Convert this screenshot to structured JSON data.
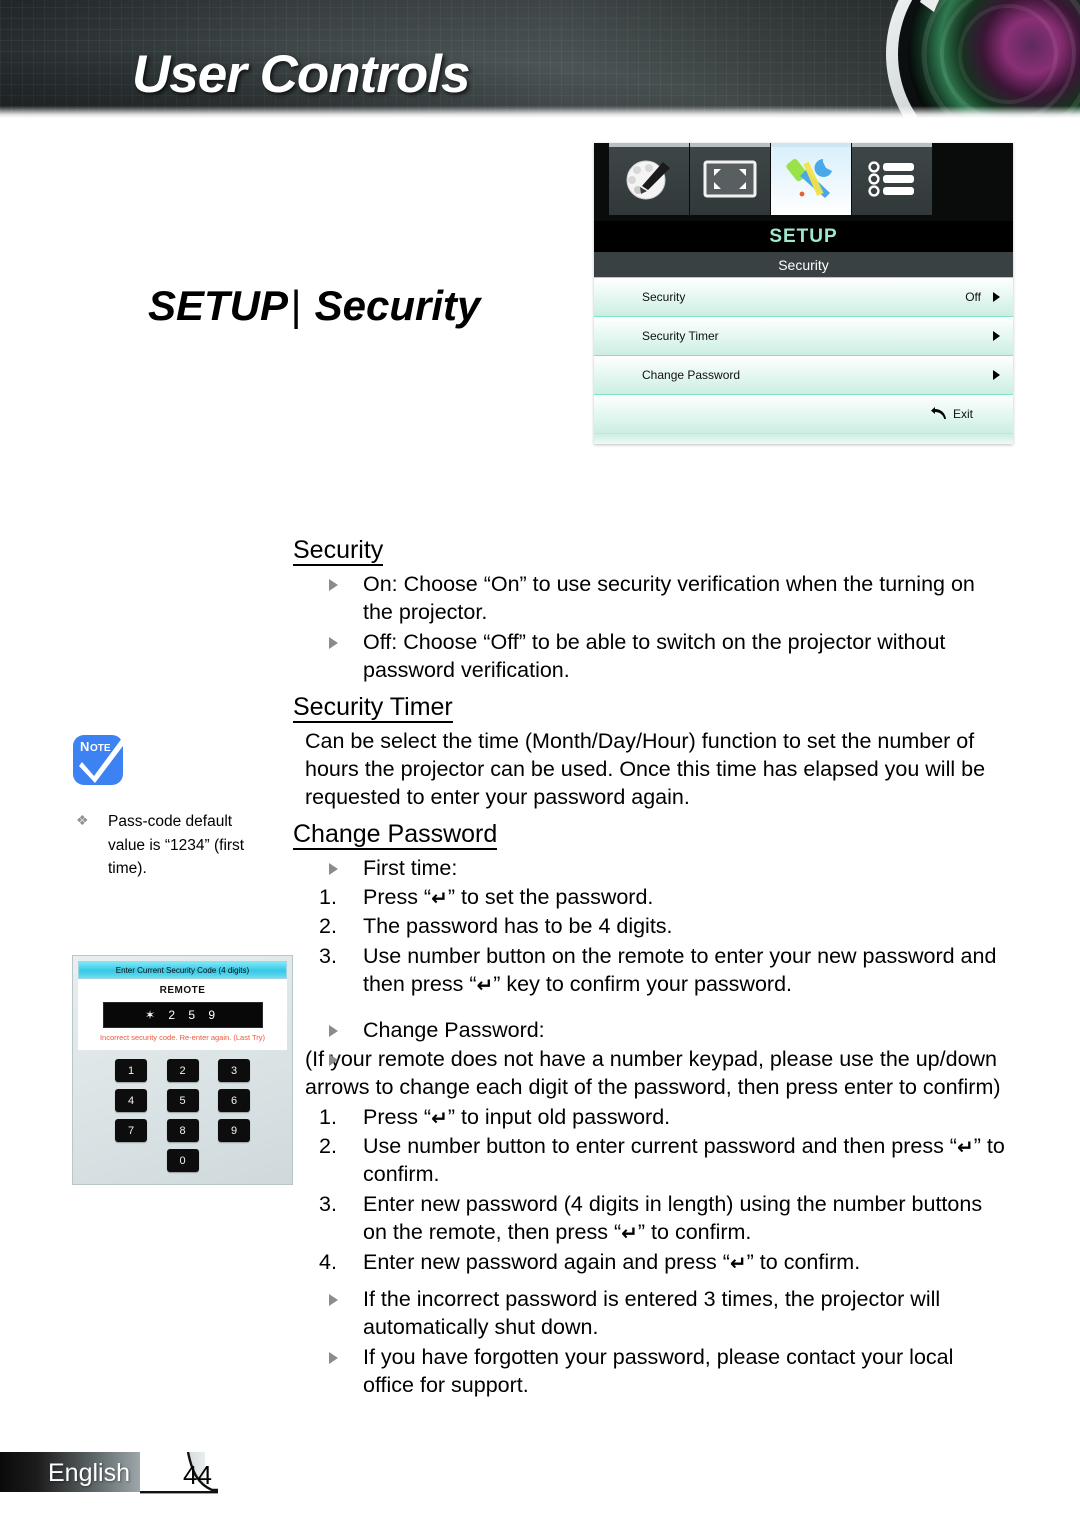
{
  "header": {
    "title": "User Controls"
  },
  "page_title": {
    "primary": "SETUP",
    "separator": "|",
    "secondary": "Security"
  },
  "osd": {
    "tabs": [
      {
        "name": "image-palette-tab",
        "icon": "palette-brush-icon",
        "selected": false
      },
      {
        "name": "display-tab",
        "icon": "screen-resize-icon",
        "selected": false
      },
      {
        "name": "setup-tab",
        "icon": "tools-icon",
        "selected": true
      },
      {
        "name": "options-tab",
        "icon": "list-options-icon",
        "selected": false
      }
    ],
    "title": "SETUP",
    "subtitle": "Security",
    "rows": [
      {
        "label": "Security",
        "value": "Off"
      },
      {
        "label": "Security Timer",
        "value": ""
      },
      {
        "label": "Change Password",
        "value": ""
      }
    ],
    "exit_label": "Exit",
    "accent_color": "#9fe8cf",
    "row_color": "#ddf5ec"
  },
  "sections": [
    {
      "heading": "Security",
      "bullets": [
        "On: Choose “On” to use security verification when the turning on the projector.",
        "Off: Choose “Off” to be able to switch on the projector without password verification."
      ]
    },
    {
      "heading": "Security Timer",
      "paragraph": "Can be select the time (Month/Day/Hour) function to set the number of hours the projector can be used. Once this time has elapsed you will be requested to enter your password again."
    },
    {
      "heading": "Change Password"
    }
  ],
  "change_password": {
    "first_time_bullet": "First time:",
    "first_time_steps": [
      {
        "n": "1.",
        "pre": "Press “",
        "post": "” to set the password."
      },
      {
        "n": "2.",
        "pre": "",
        "post": "The password has to be 4 digits.",
        "no_key": true
      },
      {
        "n": "3.",
        "pre": "Use number button on the remote to enter your new password and then press “",
        "post": "” key to confirm your password.",
        "key_mid": true
      }
    ],
    "change_bullet": "Change Password:",
    "change_note": "(If your remote does not have  a number keypad, please  use the up/down arrows to change each digit of the password, then press enter to confirm)",
    "change_steps": [
      {
        "n": "1.",
        "pre": "Press “",
        "post": "” to input old password."
      },
      {
        "n": "2.",
        "pre": "Use number button to enter current password and then press “",
        "post": "” to confirm.",
        "key_mid": true
      },
      {
        "n": "3.",
        "pre": "Enter new password (4 digits in length) using the number buttons on the remote, then press “",
        "post": "” to confirm.",
        "key_mid": true
      },
      {
        "n": "4.",
        "pre": "Enter new password again and press “",
        "post": "” to confirm.",
        "key_mid": true
      }
    ],
    "trailing_bullets": [
      "If the incorrect password is entered 3 times, the projector will automatically shut down.",
      "If you have forgotten your password, please contact your local office for support."
    ],
    "enter_key_glyph": "↵"
  },
  "note": {
    "badge_label": "Note",
    "text": "Pass-code default value is “1234” (first time)."
  },
  "dialog": {
    "title": "Enter Current Security Code (4 digits)",
    "device_label": "REMOTE",
    "code_value": "✶ 2 5 9",
    "error": "Incorrect security code. Re-enter again. (Last Try)",
    "keypad": [
      [
        "1",
        "2",
        "3"
      ],
      [
        "4",
        "5",
        "6"
      ],
      [
        "7",
        "8",
        "9"
      ],
      [
        "0"
      ]
    ],
    "title_color": "#35c8e6",
    "error_color": "#f0583c"
  },
  "footer": {
    "language": "English",
    "page_number": "44"
  }
}
